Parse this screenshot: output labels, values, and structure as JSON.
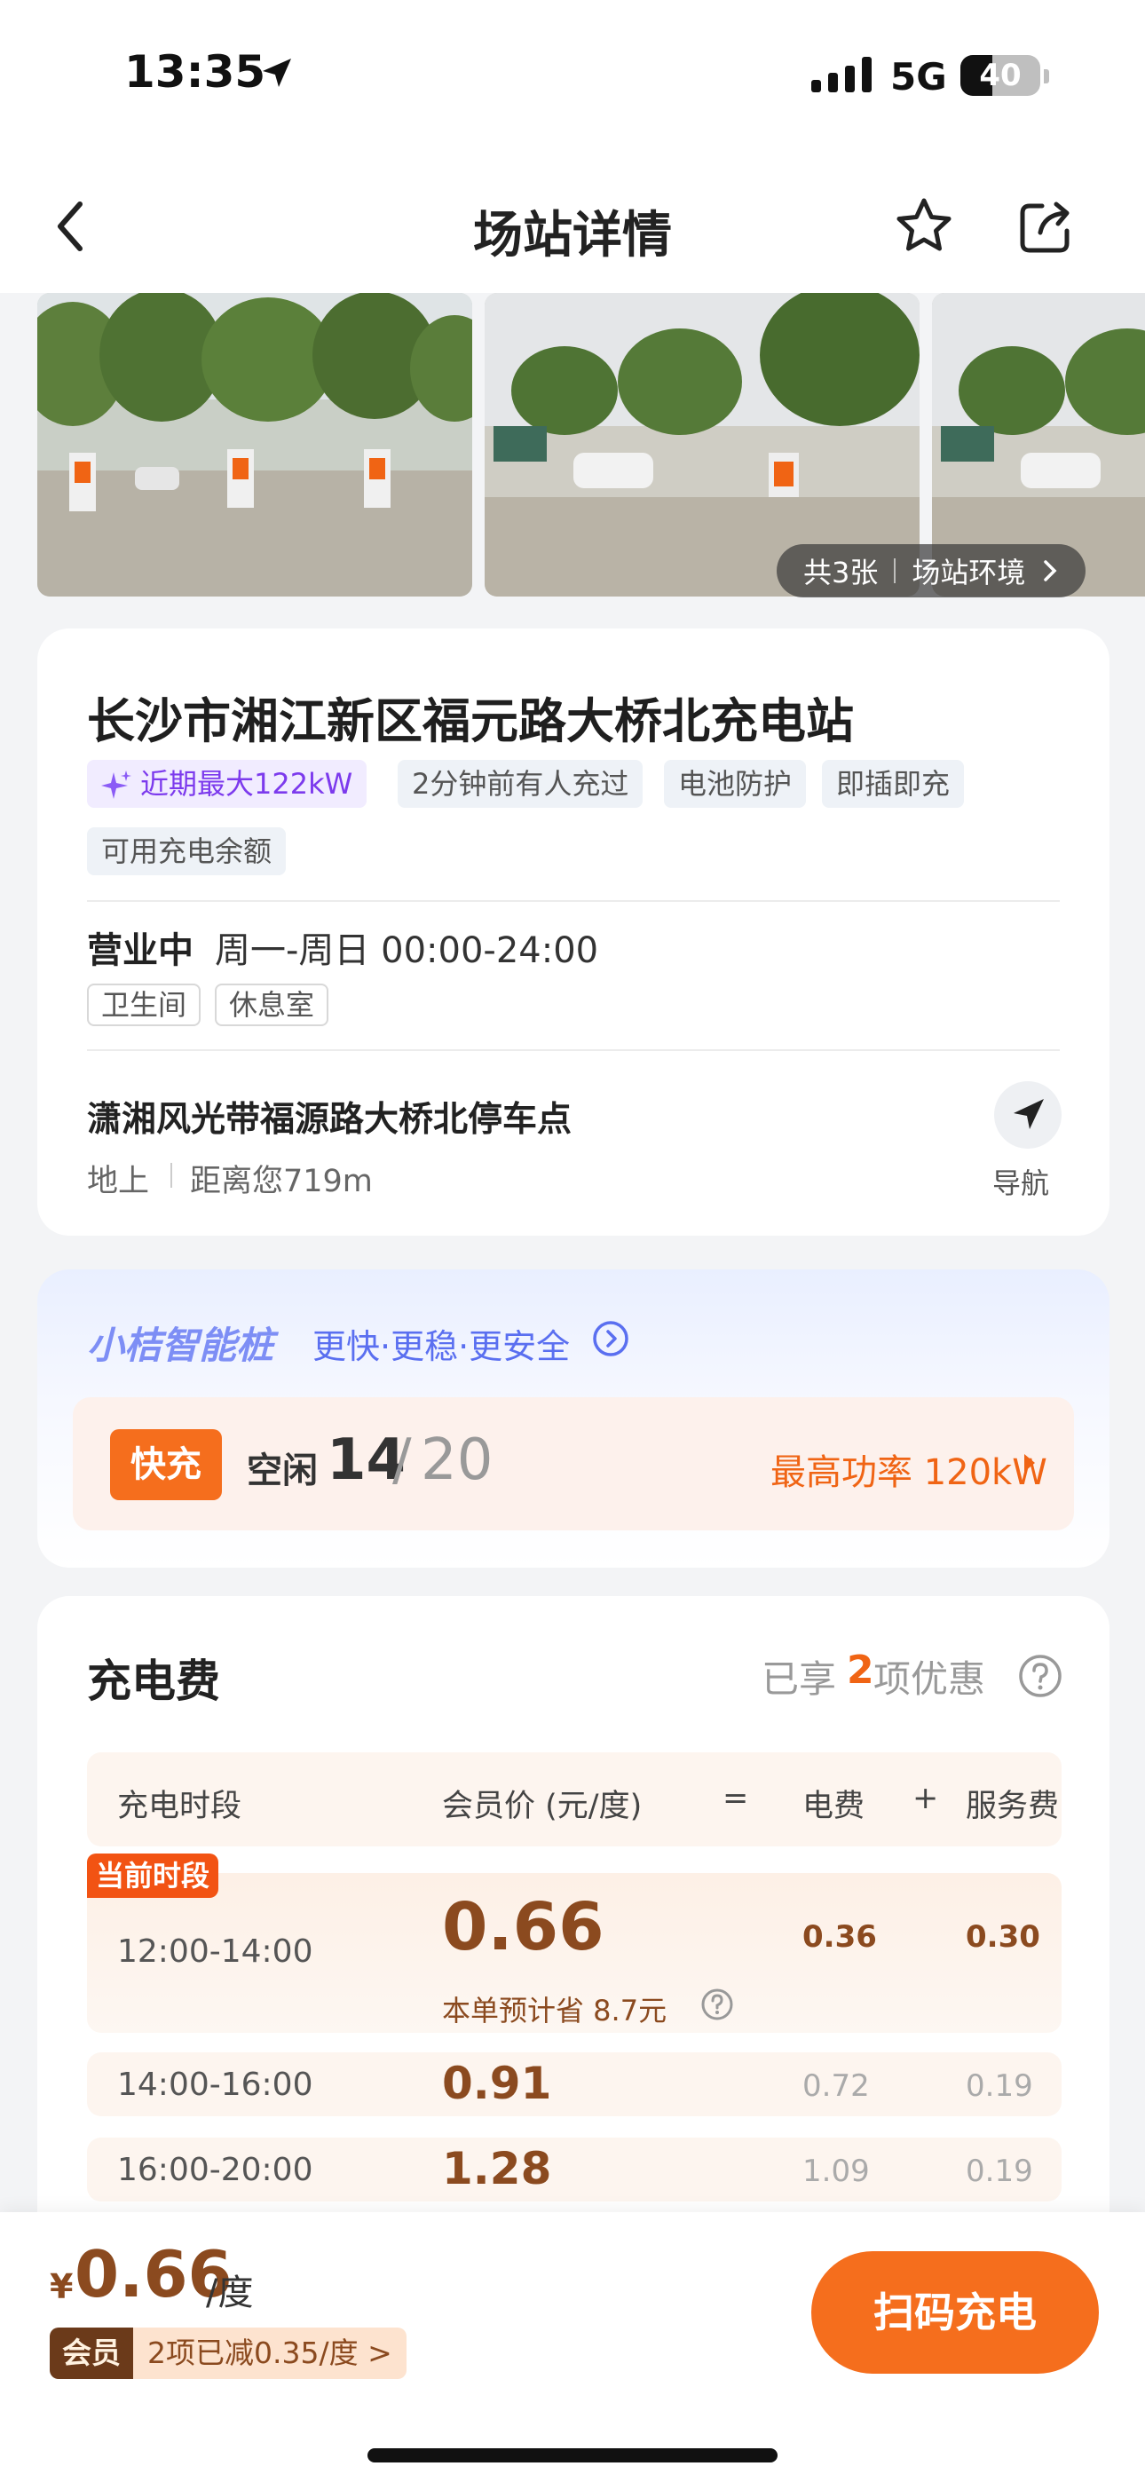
{
  "status_bar": {
    "time": "13:35",
    "network": "5G",
    "battery": "40",
    "battery_level": 0.4
  },
  "nav": {
    "title": "场站详情",
    "back_icon": "chevron-left-icon",
    "favorite_icon": "star-icon",
    "share_icon": "share-icon"
  },
  "gallery": {
    "count_label": "共3张",
    "env_label": "场站环境"
  },
  "station": {
    "name": "长沙市湘江新区福元路大桥北充电站",
    "tags": [
      "近期最大122kW",
      "2分钟前有人充过",
      "电池防护",
      "即插即充",
      "可用充电余额"
    ],
    "status": "营业中",
    "hours": "周一-周日 00:00-24:00",
    "facilities": [
      "卫生间",
      "休息室"
    ],
    "address": "潇湘风光带福源路大桥北停车点",
    "floor": "地上",
    "distance": "距离您719m",
    "nav_label": "导航"
  },
  "pile": {
    "brand": "小桔智能桩",
    "slogan": "更快·更稳·更安全",
    "type": "快充",
    "idle_label": "空闲",
    "idle": "14",
    "slash": "/",
    "total": "20",
    "max_power": "最高功率 120kW"
  },
  "fee": {
    "title": "充电费",
    "discount_prefix": "已享",
    "discount_count": "2",
    "discount_suffix": "项优惠",
    "headers": {
      "period": "充电时段",
      "member_price": "会员价 (元/度)",
      "eq": "=",
      "electric": "电费",
      "plus": "+",
      "service": "服务费"
    },
    "current_badge": "当前时段",
    "rows": [
      {
        "period": "12:00-14:00",
        "price": "0.66",
        "electric": "0.36",
        "service": "0.30",
        "save": "本单预计省 8.7元"
      },
      {
        "period": "14:00-16:00",
        "price": "0.91",
        "electric": "0.72",
        "service": "0.19"
      },
      {
        "period": "16:00-20:00",
        "price": "1.28",
        "electric": "1.09",
        "service": "0.19"
      }
    ]
  },
  "bottom": {
    "currency": "¥",
    "price": "0.66",
    "unit": "/度",
    "member_label": "会员",
    "member_discount": "2项已减0.35/度 >",
    "scan_label": "扫码充电"
  },
  "colors": {
    "accent": "#f56e1d",
    "price": "#8b4a1f",
    "purple": "#7c3aed"
  }
}
